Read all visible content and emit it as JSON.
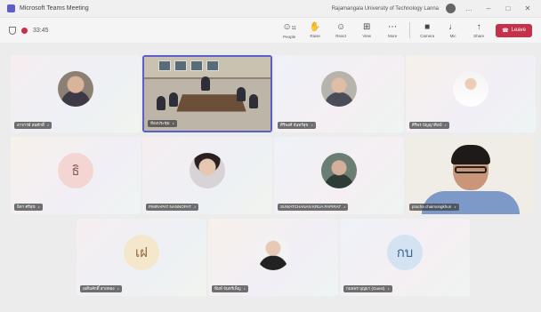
{
  "window": {
    "title": "Microsoft Teams Meeting",
    "org": "Rajamangala University of Technology Lanna",
    "controls": [
      "…",
      "–",
      "□",
      "✕"
    ]
  },
  "toolbar": {
    "timer": "33:45",
    "tools": [
      {
        "icon": "people-icon",
        "glyph": "☺",
        "label": "People",
        "badge": "11"
      },
      {
        "icon": "raise-hand-icon",
        "glyph": "✋",
        "label": "Raise"
      },
      {
        "icon": "react-icon",
        "glyph": "☺",
        "label": "React"
      },
      {
        "icon": "view-icon",
        "glyph": "⊞",
        "label": "View"
      },
      {
        "icon": "more-icon",
        "glyph": "⋯",
        "label": "More"
      },
      {
        "icon": "camera-icon",
        "glyph": "■",
        "label": "Camera"
      },
      {
        "icon": "mic-icon",
        "glyph": "♩",
        "label": "Mic"
      },
      {
        "icon": "share-icon",
        "glyph": "↑",
        "label": "Share"
      }
    ],
    "leave_label": "Leave",
    "leave_icon": "☎"
  },
  "participants": [
    {
      "name": "อาจารย์ สมศักดิ์",
      "kind": "photo1"
    },
    {
      "name": "ห้องประชุม",
      "kind": "room"
    },
    {
      "name": "ศิริพงศ์ จันทร์สุข",
      "kind": "photo2"
    },
    {
      "name": "ศิริพร ปัญญาศิลป์",
      "kind": "photo3"
    },
    {
      "name": "ธิดา ศรีสุข",
      "kind": "initials-pink",
      "initials": "ธิ"
    },
    {
      "name": "PIMRAPAT NANNOPAT",
      "kind": "photo4"
    },
    {
      "name": "SUWATCHANAN KRUA PAPIRAT",
      "kind": "photo5"
    },
    {
      "name": "pracha chaimongkhun",
      "kind": "video-man"
    },
    {
      "name": "เผดิมศักดิ์ สายทอง",
      "kind": "initials-cream",
      "initials": "เฝ"
    },
    {
      "name": "พิมพ์ จันทร์เพ็ญ",
      "kind": "photo6"
    },
    {
      "name": "กมลพร บุญมา (Guest)",
      "kind": "initials-blue",
      "initials": "กบ"
    }
  ],
  "colors": {
    "accent": "#5b5fc7",
    "leave": "#c4314b",
    "background": "#ececec"
  }
}
